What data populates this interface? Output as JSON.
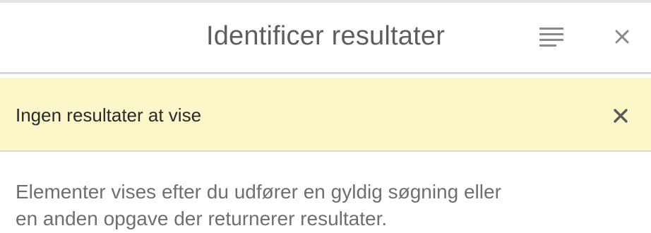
{
  "header": {
    "title": "Identificer resultater",
    "menu_icon": "menu-lines-icon",
    "close_icon": "close-icon"
  },
  "alert": {
    "message": "Ingen resultater at vise",
    "close_icon": "close-icon",
    "background": "#fbf7c9"
  },
  "info": {
    "line1": "Elementer vises efter du udfører en gyldig søgning eller",
    "line2": "en anden opgave der returnerer resultater."
  }
}
